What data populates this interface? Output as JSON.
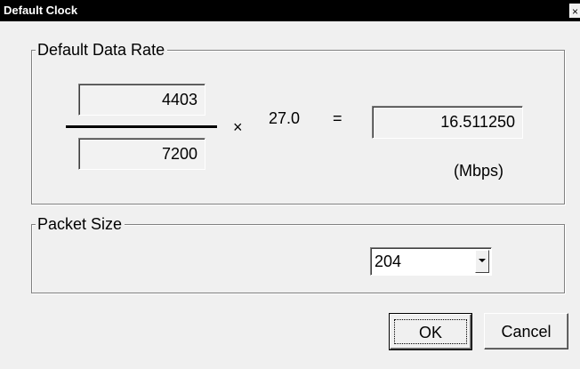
{
  "window": {
    "title": "Default Clock",
    "close_glyph": "×"
  },
  "data_rate_group": {
    "legend": "Default Data Rate",
    "numerator": "4403",
    "denominator": "7200",
    "multiply_sign": "×",
    "factor": "27.0",
    "equals_sign": "=",
    "result": "16.511250",
    "unit": "(Mbps)"
  },
  "packet_group": {
    "legend": "Packet Size",
    "packet_size_value": "204",
    "dropdown_icon": "chevron-down-icon"
  },
  "buttons": {
    "ok_label": "OK",
    "cancel_label": "Cancel"
  },
  "colors": {
    "titlebar": "#000000",
    "dialog_face": "#f0f0f0"
  }
}
